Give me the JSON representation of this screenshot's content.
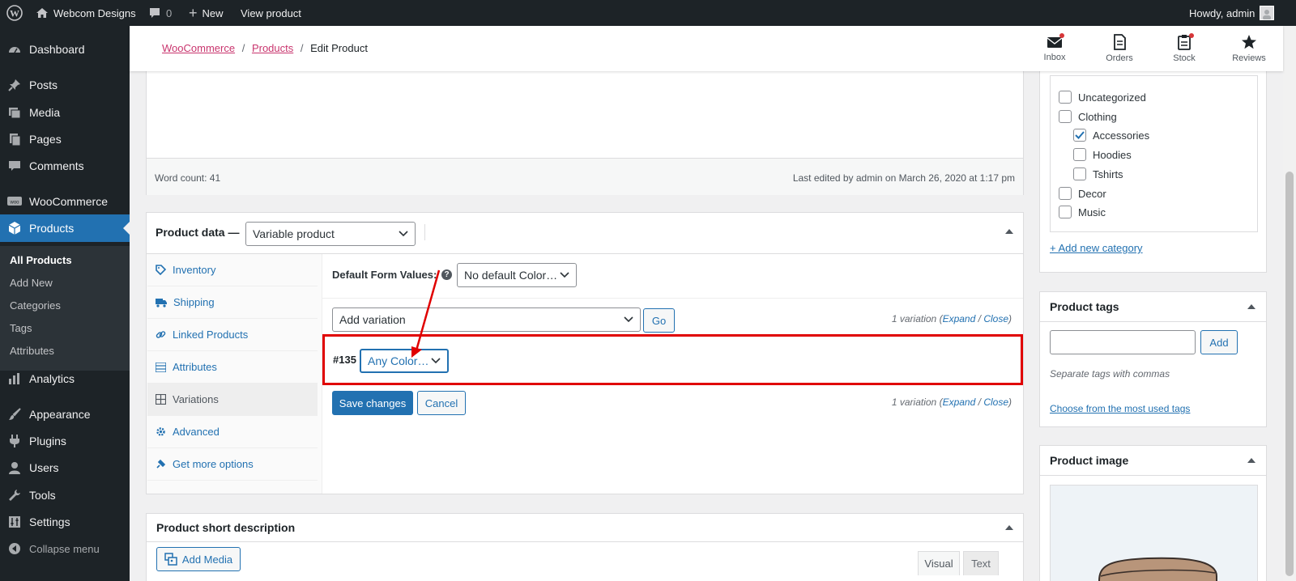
{
  "adminbar": {
    "site_name": "Webcom Designs",
    "comments_count": "0",
    "new_label": "New",
    "view_label": "View product",
    "howdy": "Howdy, admin"
  },
  "sidebar": {
    "dashboard": "Dashboard",
    "posts": "Posts",
    "media": "Media",
    "pages": "Pages",
    "comments": "Comments",
    "woocommerce": "WooCommerce",
    "products": "Products",
    "submenu": [
      "All Products",
      "Add New",
      "Categories",
      "Tags",
      "Attributes"
    ],
    "analytics": "Analytics",
    "appearance": "Appearance",
    "plugins": "Plugins",
    "users": "Users",
    "tools": "Tools",
    "settings": "Settings",
    "collapse": "Collapse menu"
  },
  "header": {
    "breadcrumb_1": "WooCommerce",
    "breadcrumb_2": "Products",
    "breadcrumb_3": "Edit Product",
    "sep": "/",
    "inbox": "Inbox",
    "orders": "Orders",
    "stock": "Stock",
    "reviews": "Reviews"
  },
  "editor": {
    "word_count": "Word count: 41",
    "last_edited": "Last edited by admin on March 26, 2020 at 1:17 pm"
  },
  "product_data": {
    "title": "Product data —",
    "type_value": "Variable product",
    "tabs": [
      "Inventory",
      "Shipping",
      "Linked Products",
      "Attributes",
      "Variations",
      "Advanced",
      "Get more options"
    ],
    "default_form_label": "Default Form Values:",
    "help_glyph": "?",
    "default_color": "No default Color…",
    "add_variation": "Add variation",
    "go": "Go",
    "variation_count": "1 variation",
    "expand": "Expand",
    "close": "Close",
    "slash": "/",
    "variation_id": "#135",
    "any_color": "Any Color…",
    "save_changes": "Save changes",
    "cancel": "Cancel"
  },
  "short_desc": {
    "title": "Product short description",
    "add_media": "Add Media",
    "visual": "Visual",
    "text": "Text"
  },
  "categories": {
    "items": [
      "Uncategorized",
      "Clothing",
      "Accessories",
      "Hoodies",
      "Tshirts",
      "Decor",
      "Music"
    ],
    "add_new": "+ Add new category"
  },
  "tags": {
    "title": "Product tags",
    "add": "Add",
    "hint": "Separate tags with commas",
    "choose": "Choose from the most used tags"
  },
  "image": {
    "title": "Product image"
  },
  "colors": {
    "accent": "#2271b1",
    "highlight": "#e00000",
    "breadcrumb": "#c9356e"
  }
}
